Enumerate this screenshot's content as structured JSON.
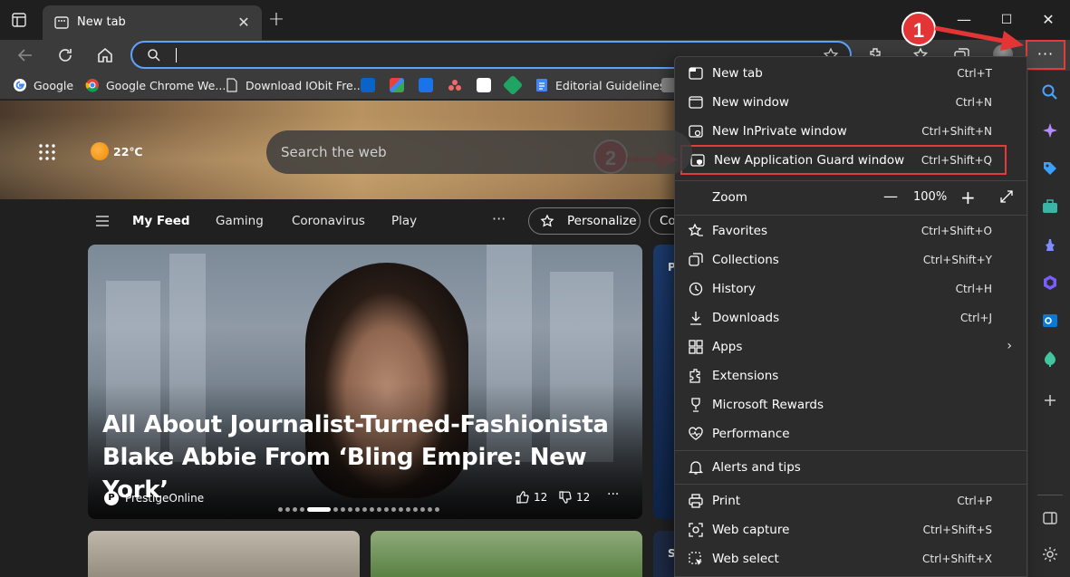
{
  "tab": {
    "title": "New tab",
    "close": "✕"
  },
  "window": {
    "minimize": "—",
    "maximize": "☐",
    "close": "✕"
  },
  "address": {
    "value": "",
    "placeholder": ""
  },
  "bookmarks": [
    {
      "label": "Google",
      "color": "#ffffff"
    },
    {
      "label": "Google Chrome We...",
      "color": "#e8453c"
    },
    {
      "label": "Download IObit Fre...",
      "color": "#3b3b3b"
    },
    {
      "label": "Editorial Guidelines",
      "color": "#4285f4"
    }
  ],
  "hero": {
    "temperature": "22℃",
    "search_placeholder": "Search the web"
  },
  "feed": {
    "links": [
      "My Feed",
      "Gaming",
      "Coronavirus",
      "Play"
    ],
    "more": "···",
    "personalize": "Personalize",
    "next_pill": "Co"
  },
  "main_card": {
    "title": "All About Journalist-Turned-Fashionista Blake Abbie From ‘Bling Empire: New York’",
    "source_logo": "P",
    "source": "PrestigeOnline",
    "likes": "12",
    "dislikes": "12",
    "more": "···"
  },
  "side_card": {
    "letter_top": "P",
    "letter_bottom": "S"
  },
  "more_button": "···",
  "menu": {
    "new_tab": {
      "label": "New tab",
      "shortcut": "Ctrl+T"
    },
    "new_window": {
      "label": "New window",
      "shortcut": "Ctrl+N"
    },
    "inprivate": {
      "label": "New InPrivate window",
      "shortcut": "Ctrl+Shift+N"
    },
    "app_guard": {
      "label": "New Application Guard window",
      "shortcut": "Ctrl+Shift+Q"
    },
    "zoom": {
      "label": "Zoom",
      "value": "100%",
      "minus": "—",
      "plus": "+"
    },
    "favorites": {
      "label": "Favorites",
      "shortcut": "Ctrl+Shift+O"
    },
    "collections": {
      "label": "Collections",
      "shortcut": "Ctrl+Shift+Y"
    },
    "history": {
      "label": "History",
      "shortcut": "Ctrl+H"
    },
    "downloads": {
      "label": "Downloads",
      "shortcut": "Ctrl+J"
    },
    "apps": {
      "label": "Apps",
      "arrow": "›"
    },
    "extensions": {
      "label": "Extensions"
    },
    "rewards": {
      "label": "Microsoft Rewards"
    },
    "performance": {
      "label": "Performance"
    },
    "alerts": {
      "label": "Alerts and tips"
    },
    "print": {
      "label": "Print",
      "shortcut": "Ctrl+P"
    },
    "web_capture": {
      "label": "Web capture",
      "shortcut": "Ctrl+Shift+S"
    },
    "web_select": {
      "label": "Web select",
      "shortcut": "Ctrl+Shift+X"
    }
  },
  "callouts": {
    "one": "1",
    "two": "2"
  },
  "colors": {
    "accent": "#5ea2ff",
    "highlight": "#e23b3b",
    "menu_bg": "#2c2c2c"
  }
}
